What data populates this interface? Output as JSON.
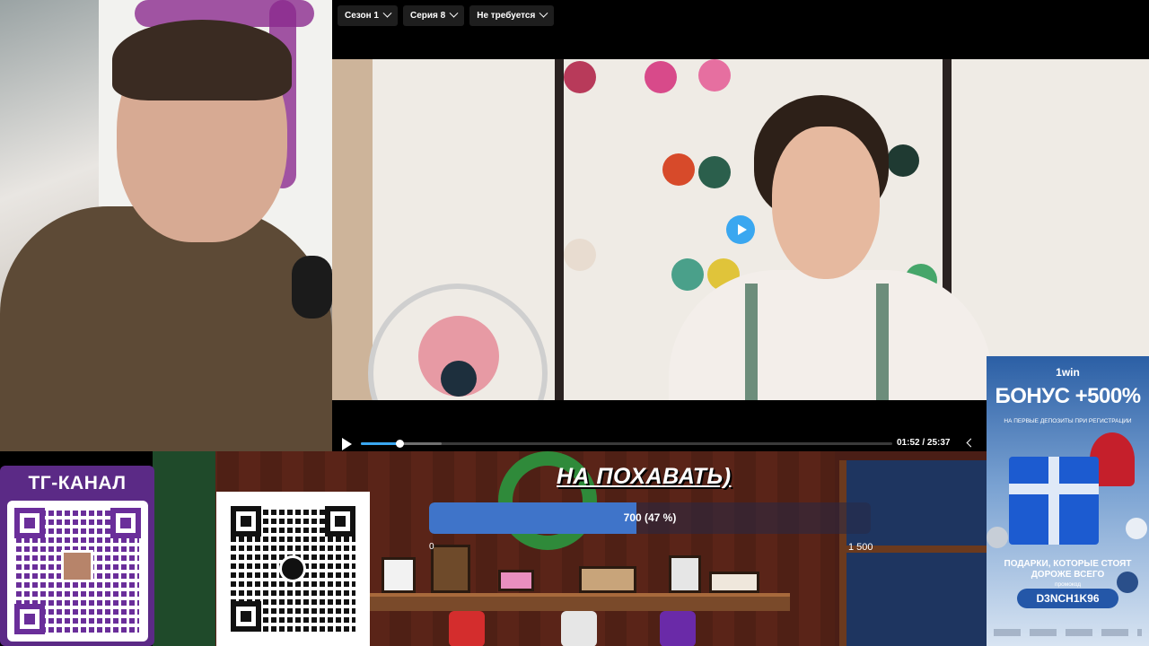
{
  "player": {
    "season_label": "Сезон 1",
    "episode_label": "Серия 8",
    "audio_label": "Не требуется",
    "current_time": "01:52",
    "separator": "/",
    "duration": "25:37",
    "progress": 0.073,
    "buffered": 0.152,
    "accent_color": "#3aa7f0"
  },
  "stream": {
    "tg_channel_label": "ТГ-КАНАЛ",
    "goal_title": "НА ПОХАВАТЬ)",
    "goal_text": "700 (47 %)",
    "goal_fraction": 0.47,
    "goal_min": "0",
    "goal_max": "1 500",
    "goal_color": "#3f74c9"
  },
  "ad": {
    "brand": "1win",
    "bonus": "БОНУС +500%",
    "subtitle": "НА ПЕРВЫЕ ДЕПОЗИТЫ ПРИ РЕГИСТРАЦИИ",
    "tagline": "ПОДАРКИ, КОТОРЫЕ СТОЯТ ДОРОЖЕ ВСЕГО",
    "promo_label": "промокод",
    "promo_code": "D3NCH1K96"
  }
}
